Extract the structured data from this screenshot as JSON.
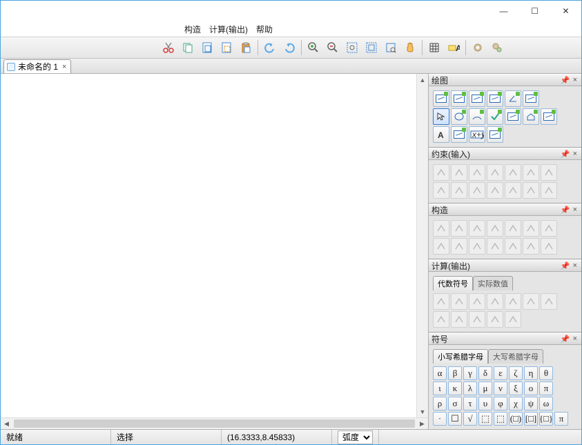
{
  "window": {
    "minimize": "—",
    "maximize": "☐",
    "close": "✕"
  },
  "menu": {
    "construct": "构造",
    "compute": "计算(输出)",
    "help": "帮助"
  },
  "tab": {
    "title": "未命名的 1",
    "close": "×"
  },
  "panels": {
    "draw": "绘图",
    "constraint": "约束(输入)",
    "construct": "构造",
    "compute": "计算(输出)",
    "compute_tabs": {
      "alg": "代数符号",
      "num": "实际数值"
    },
    "symbols": "符号",
    "symbols_tabs": {
      "lower": "小写希腊字母",
      "upper": "大写希腊字母"
    },
    "pin": "📌",
    "close": "×"
  },
  "greek_rows": [
    [
      "α",
      "β",
      "γ",
      "δ",
      "ε",
      "ζ",
      "η",
      "θ"
    ],
    [
      "ι",
      "κ",
      "λ",
      "μ",
      "ν",
      "ξ",
      "ο",
      "π"
    ],
    [
      "ρ",
      "σ",
      "τ",
      "υ",
      "φ",
      "χ",
      "ψ",
      "ω"
    ],
    [
      "·",
      "☐",
      "√",
      "⬚",
      "⬚",
      "(□)",
      "[□]",
      "{□}",
      "π"
    ]
  ],
  "status": {
    "ready": "就绪",
    "select": "选择",
    "coord": "(16.3333,8.45833)",
    "angle_mode": "弧度"
  },
  "toolbar_icons": [
    "scissors",
    "copy",
    "paste-a",
    "paste-b",
    "paste-c",
    "sep",
    "undo",
    "redo",
    "sep",
    "zoom-in",
    "zoom-out",
    "zoom-area",
    "zoom-fit",
    "zoom-sel",
    "hand",
    "sep",
    "grid",
    "dim",
    "sep",
    "gear1",
    "gear2"
  ],
  "colors": {
    "accent": "#2a6ab8",
    "green": "#5fbf3f"
  }
}
